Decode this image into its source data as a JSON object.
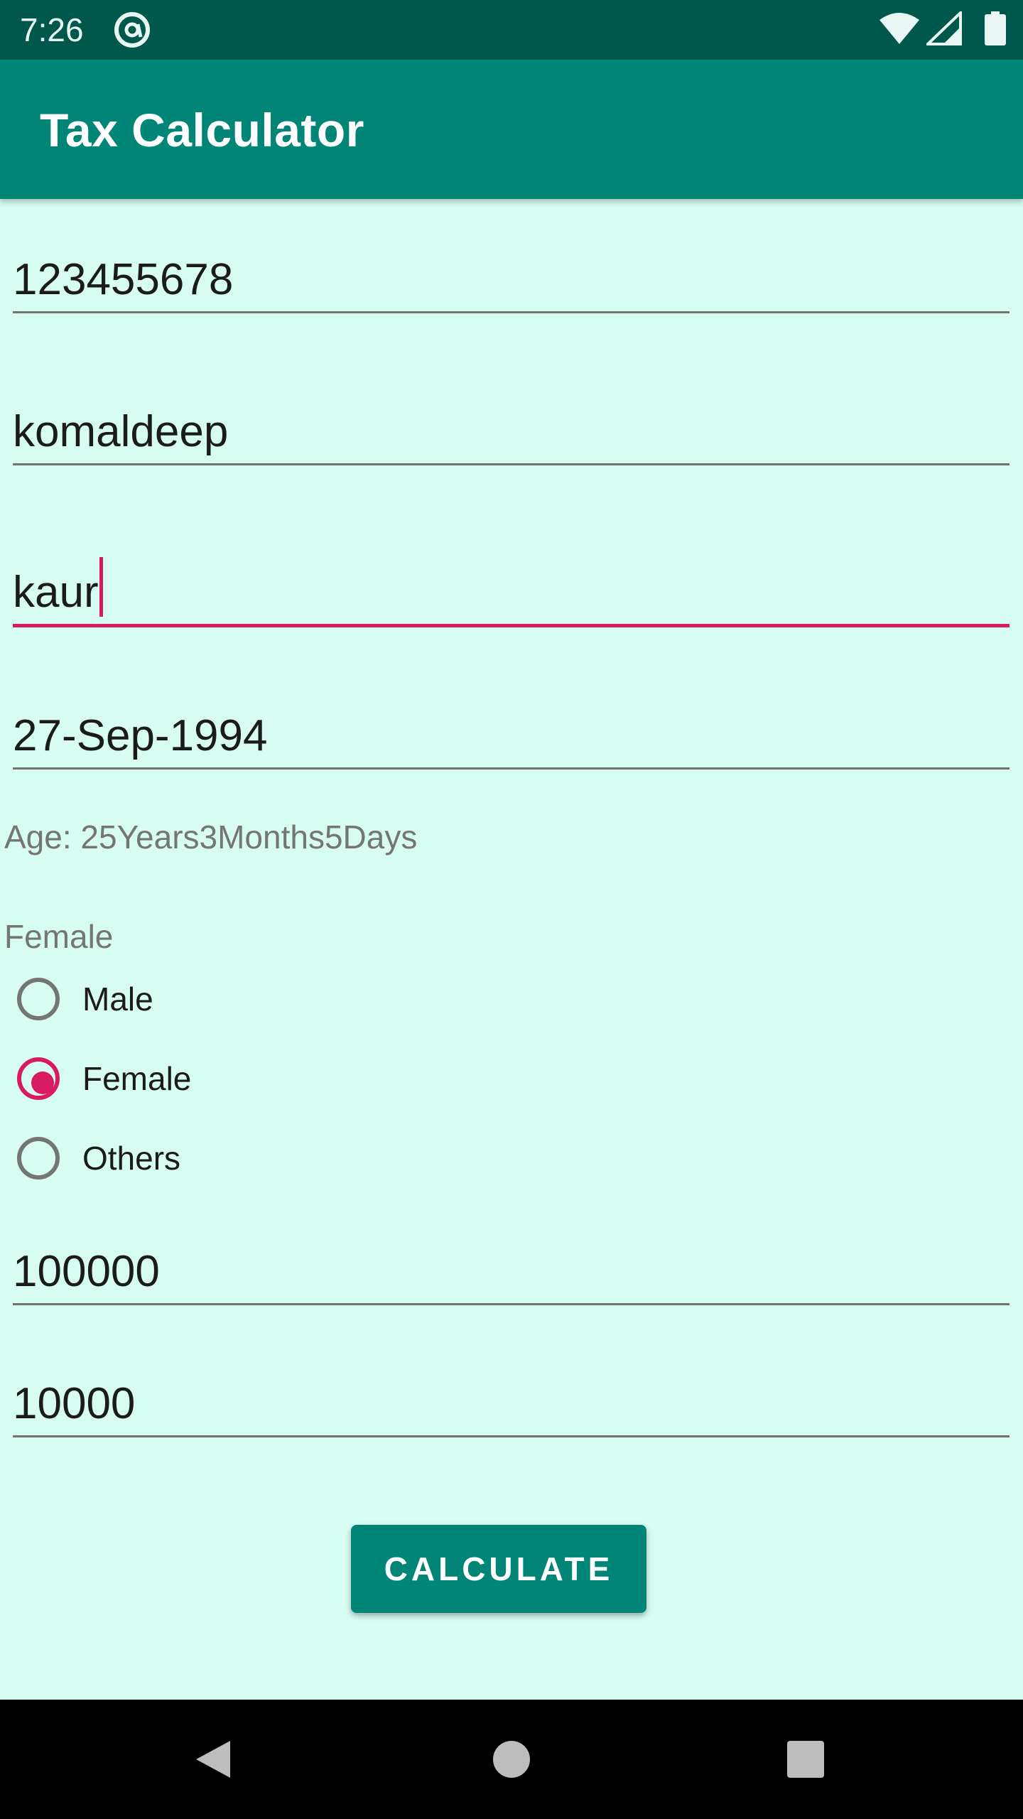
{
  "status_bar": {
    "time": "7:26",
    "icons": [
      "at-sign-icon",
      "wifi-icon",
      "signal-icon",
      "battery-icon"
    ]
  },
  "app_bar": {
    "title": "Tax Calculator"
  },
  "form": {
    "sin_value": "123455678",
    "first_name_value": "komaldeep",
    "last_name_value": "kaur",
    "dob_value": "27-Sep-1994",
    "age_text": "Age: 25Years3Months5Days",
    "gender_selected_label": "Female",
    "gender_options": [
      {
        "label": "Male",
        "checked": false
      },
      {
        "label": "Female",
        "checked": true
      },
      {
        "label": "Others",
        "checked": false
      }
    ],
    "income_value": "100000",
    "rrsp_value": "10000",
    "calculate_label": "CALCULATE"
  },
  "colors": {
    "status_bar": "#00574b",
    "app_bar": "#008577",
    "background": "#d7fcf2",
    "accent": "#d81b60"
  },
  "nav_bar": {
    "buttons": [
      "back-icon",
      "home-icon",
      "recents-icon"
    ]
  }
}
